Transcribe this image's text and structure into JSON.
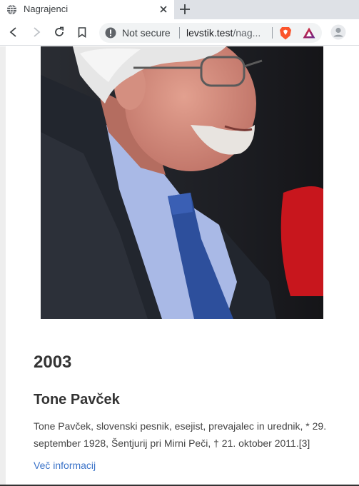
{
  "browser": {
    "tab": {
      "title": "Nagrajenci",
      "favicon": "globe-icon"
    },
    "toolbar": {
      "security_label": "Not secure",
      "url_host": "levstik.test",
      "url_path": "/nag..."
    },
    "icons": {
      "back": "back-icon",
      "forward": "forward-icon",
      "reload": "reload-icon",
      "bookmark": "bookmark-icon",
      "brave": "brave-shield-icon",
      "rewards": "brave-rewards-icon",
      "profile": "profile-icon"
    }
  },
  "page": {
    "year": "2003",
    "name": "Tone Pavček",
    "bio": "Tone Pavček, slovenski pesnik, esejist, prevajalec in urednik, * 29. september 1928, Šentjurij pri Mirni Peči, † 21. oktober 2011.[3]",
    "more_link": "Več informacij"
  },
  "colors": {
    "link": "#3b73c8",
    "heading": "#333333",
    "brave_orange": "#fb542b"
  }
}
